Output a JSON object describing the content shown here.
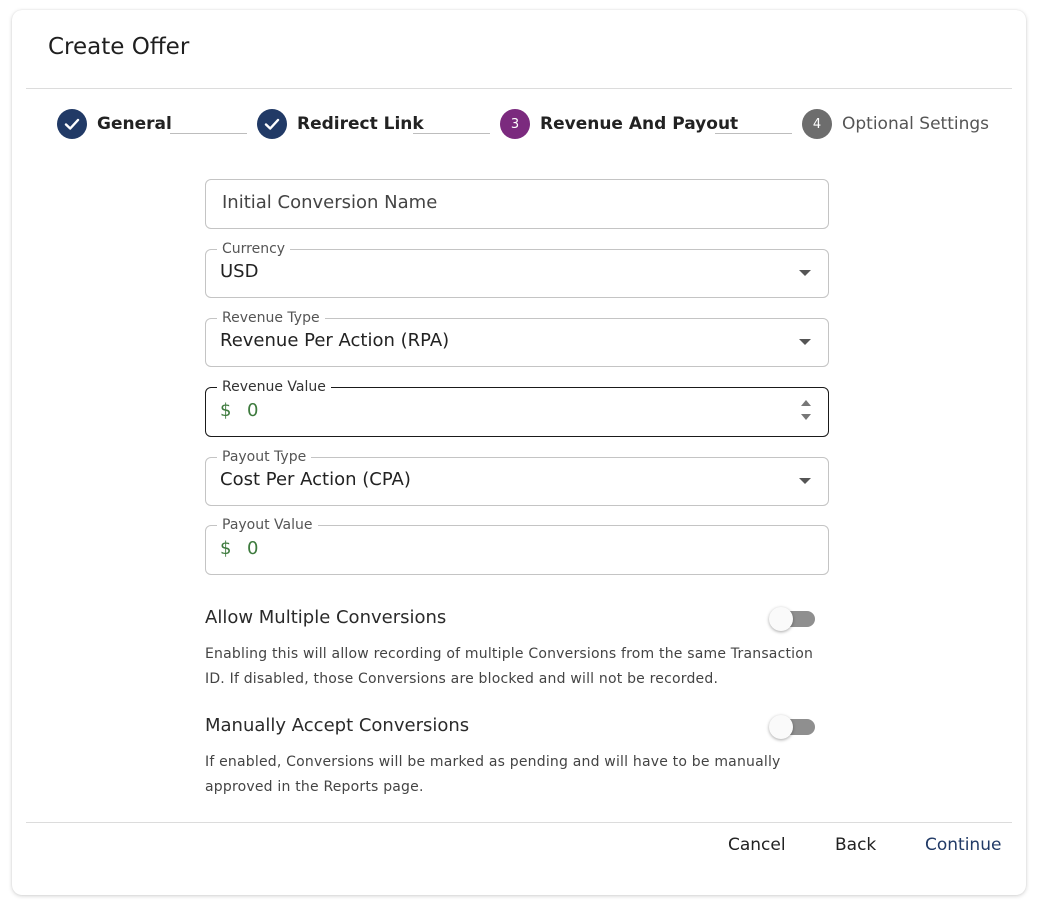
{
  "dialog": {
    "title": "Create Offer"
  },
  "colors": {
    "step_complete": "#213a66",
    "step_active": "#7b2a7e",
    "step_inactive": "#6d6d6d",
    "money_text": "#3d7a3d"
  },
  "stepper": {
    "steps": [
      {
        "label": "General",
        "state": "complete",
        "icon": "check-icon"
      },
      {
        "label": "Redirect Link",
        "state": "complete",
        "icon": "check-icon"
      },
      {
        "label": "Revenue And Payout",
        "state": "active",
        "number": "3"
      },
      {
        "label": "Optional Settings",
        "state": "inactive",
        "number": "4"
      }
    ]
  },
  "form": {
    "initial_conversion_name": {
      "placeholder": "Initial Conversion Name",
      "value": ""
    },
    "currency": {
      "label": "Currency",
      "value": "USD"
    },
    "revenue_type": {
      "label": "Revenue Type",
      "value": "Revenue Per Action (RPA)"
    },
    "revenue_value": {
      "label": "Revenue Value",
      "prefix": "$",
      "value": "0"
    },
    "payout_type": {
      "label": "Payout Type",
      "value": "Cost Per Action (CPA)"
    },
    "payout_value": {
      "label": "Payout Value",
      "prefix": "$",
      "value": "0"
    }
  },
  "toggles": {
    "allow_multiple": {
      "title": "Allow Multiple Conversions",
      "line1": "Enabling this will allow recording of multiple Conversions from the same Transaction",
      "line2": "ID. If disabled, those Conversions are blocked and will not be recorded.",
      "checked": false
    },
    "manual_accept": {
      "title": "Manually Accept Conversions",
      "line1": "If enabled, Conversions will be marked as pending and will have to be manually",
      "line2": "approved in the Reports page.",
      "checked": false
    }
  },
  "footer": {
    "cancel": "Cancel",
    "back": "Back",
    "continue": "Continue"
  }
}
